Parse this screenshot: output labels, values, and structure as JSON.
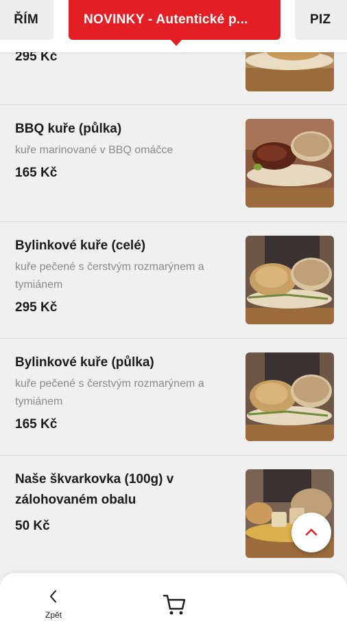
{
  "categories": {
    "left": "ŘÍM",
    "active": "NOVINKY - Autentické p...",
    "right": "PIZ"
  },
  "items": [
    {
      "name": "",
      "desc": "",
      "price": "295 Kč"
    },
    {
      "name": "BBQ kuře (půlka)",
      "desc": "kuře marinované v BBQ omáčce",
      "price": "165 Kč"
    },
    {
      "name": "Bylinkové kuře (celé)",
      "desc": "kuře pečené s čerstvým rozmarýnem a tymiánem",
      "price": "295 Kč"
    },
    {
      "name": "Bylinkové kuře (půlka)",
      "desc": "kuře pečené s čerstvým rozmarýnem a tymiánem",
      "price": "165 Kč"
    },
    {
      "name": "Naše škvarkovka (100g) v zálohovaném obalu",
      "desc": "",
      "price": "50 Kč"
    }
  ],
  "icons": {
    "scroll_top": "chevron-up-icon",
    "back": "chevron-left-icon",
    "cart": "cart-icon"
  },
  "bottom_bar": {
    "back_label": "Zpět"
  },
  "colors": {
    "accent": "#e31e24",
    "background": "#f0f0f0"
  }
}
